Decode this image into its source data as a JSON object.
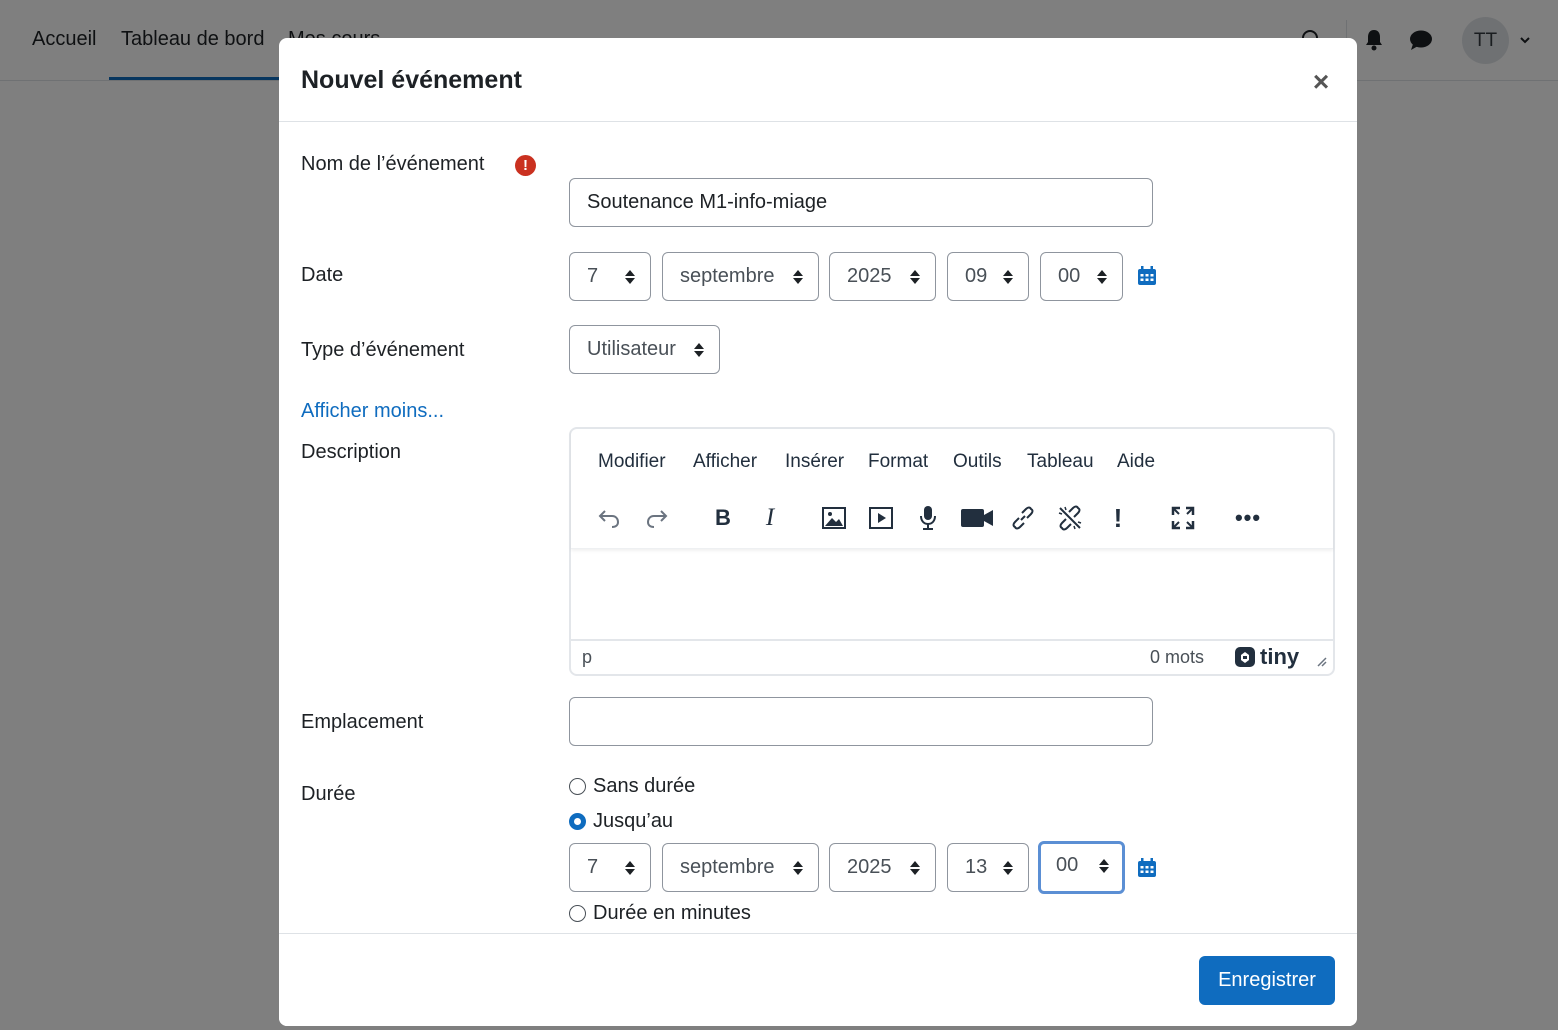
{
  "navbar": {
    "items": [
      "Accueil",
      "Tableau de bord",
      "Mes cours"
    ],
    "avatar_initials": "TT"
  },
  "modal": {
    "title": "Nouvel événement",
    "close_symbol": "×",
    "fields": {
      "event_name_label": "Nom de l’événement",
      "event_name_value": "Soutenance M1-info-miage",
      "required_symbol": "!",
      "date_label": "Date",
      "date": {
        "day": "7",
        "month": "septembre",
        "year": "2025",
        "hour": "09",
        "minute": "00"
      },
      "event_type_label": "Type d’événement",
      "event_type_value": "Utilisateur",
      "show_less_link": "Afficher moins...",
      "description_label": "Description",
      "location_label": "Emplacement",
      "location_value": "",
      "duration_label": "Durée",
      "duration_options": [
        "Sans durée",
        "Jusqu’au",
        "Durée en minutes"
      ],
      "duration_selected": "Jusqu’au",
      "until": {
        "day": "7",
        "month": "septembre",
        "year": "2025",
        "hour": "13",
        "minute": "00"
      }
    },
    "editor": {
      "menu": [
        "Modifier",
        "Afficher",
        "Insérer",
        "Format",
        "Outils",
        "Tableau",
        "Aide"
      ],
      "toolbar_icons": [
        "undo-icon",
        "redo-icon",
        "bold-icon",
        "italic-icon",
        "image-icon",
        "media-icon",
        "microphone-icon",
        "video-camera-icon",
        "link-icon",
        "unlink-icon",
        "accessibility-checker-icon",
        "fullscreen-icon",
        "more-icon"
      ],
      "bold_glyph": "B",
      "italic_glyph": "I",
      "status_path": "p",
      "word_count": "0 mots",
      "brand": "tiny"
    },
    "footer": {
      "save_label": "Enregistrer"
    }
  },
  "colors": {
    "primary": "#0f6cbf",
    "required": "#ca3120",
    "focus": "#5b8fd4"
  }
}
